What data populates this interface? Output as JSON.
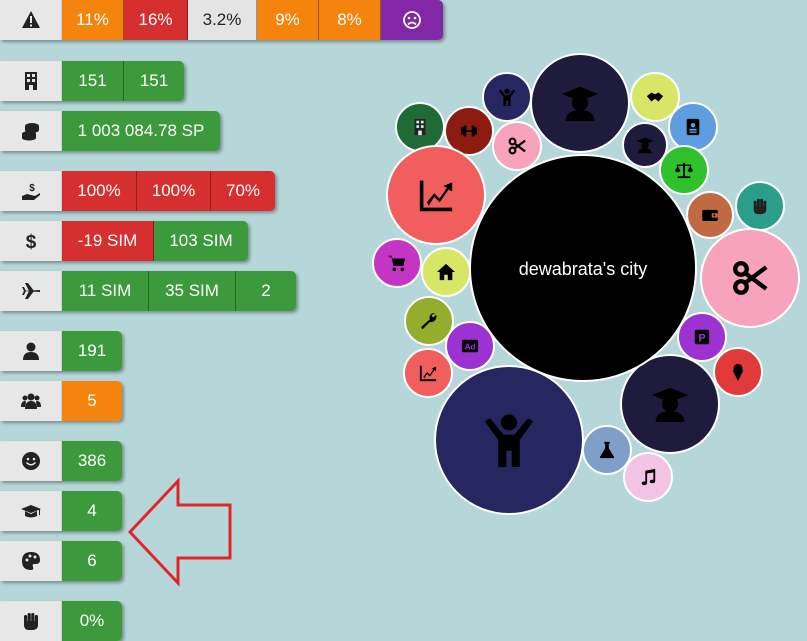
{
  "rows": [
    {
      "id": "risk",
      "icon": "warning-icon",
      "cells": [
        {
          "text": "11%",
          "color": "orange",
          "w": 61
        },
        {
          "text": "16%",
          "color": "red",
          "w": 63
        },
        {
          "text": "3.2%",
          "color": "gray",
          "w": 68
        },
        {
          "text": "9%",
          "color": "orange",
          "w": 61
        },
        {
          "text": "8%",
          "color": "orange",
          "w": 61
        },
        {
          "text": "",
          "icon": "sad-face-icon",
          "color": "purple",
          "w": 62
        }
      ]
    },
    {
      "id": "buildings",
      "icon": "building-icon",
      "cells": [
        {
          "text": "151",
          "color": "green",
          "w": 61
        },
        {
          "text": "151",
          "color": "green",
          "w": 60
        }
      ]
    },
    {
      "id": "money",
      "icon": "coins-icon",
      "cells": [
        {
          "text": "1 003 084.78 SP",
          "color": "green",
          "w": 158
        }
      ]
    },
    {
      "id": "taxes",
      "icon": "hand-dollar-icon",
      "cells": [
        {
          "text": "100%",
          "color": "red",
          "w": 74
        },
        {
          "text": "100%",
          "color": "red",
          "w": 73
        },
        {
          "text": "70%",
          "color": "red",
          "w": 64
        }
      ]
    },
    {
      "id": "balance",
      "icon": "dollar-icon",
      "cells": [
        {
          "text": "-19 SIM",
          "color": "red",
          "w": 91
        },
        {
          "text": "103 SIM",
          "color": "green",
          "w": 94
        }
      ]
    },
    {
      "id": "flights",
      "icon": "airplane-icon",
      "cells": [
        {
          "text": "11 SIM",
          "color": "green",
          "w": 86
        },
        {
          "text": "35 SIM",
          "color": "green",
          "w": 86
        },
        {
          "text": "2",
          "color": "green",
          "w": 60
        }
      ]
    },
    {
      "id": "population",
      "icon": "person-icon",
      "cells": [
        {
          "text": "191",
          "color": "green",
          "w": 60
        }
      ]
    },
    {
      "id": "groups",
      "icon": "people-group-icon",
      "cells": [
        {
          "text": "5",
          "color": "orange",
          "w": 60
        }
      ]
    },
    {
      "id": "happiness",
      "icon": "smile-icon",
      "cells": [
        {
          "text": "386",
          "color": "green",
          "w": 60
        }
      ]
    },
    {
      "id": "education",
      "icon": "graduation-cap-icon",
      "cells": [
        {
          "text": "4",
          "color": "green",
          "w": 60
        }
      ]
    },
    {
      "id": "culture",
      "icon": "palette-icon",
      "cells": [
        {
          "text": "6",
          "color": "green",
          "w": 60
        }
      ]
    },
    {
      "id": "protest",
      "icon": "fist-icon",
      "cells": [
        {
          "text": "0%",
          "color": "green",
          "w": 60
        }
      ]
    }
  ],
  "city": {
    "name": "dewabrata's city",
    "bubbles": [
      {
        "icon": "student-icon",
        "color": "#1e1b3d"
      },
      {
        "icon": "child-icon",
        "color": "#262660"
      },
      {
        "icon": "handshake-icon",
        "color": "#d8e668"
      },
      {
        "icon": "building-icon",
        "color": "#1e6b35"
      },
      {
        "icon": "dumbbell-icon",
        "color": "#8c1c0f"
      },
      {
        "icon": "scissors-icon",
        "color": "#f7a3bd"
      },
      {
        "icon": "student-icon",
        "color": "#1e1b3d"
      },
      {
        "icon": "id-card-icon",
        "color": "#5d9de0"
      },
      {
        "icon": "balance-scale-icon",
        "color": "#2ec12c"
      },
      {
        "icon": "chart-up-icon",
        "color": "#f05e5e"
      },
      {
        "icon": "wallet-icon",
        "color": "#c06a44"
      },
      {
        "icon": "fist-icon",
        "color": "#2b9f8a"
      },
      {
        "icon": "scissors-icon",
        "color": "#f7a3bd"
      },
      {
        "icon": "cart-icon",
        "color": "#c435c4"
      },
      {
        "icon": "home-icon",
        "color": "#d8e668"
      },
      {
        "icon": "wrench-icon",
        "color": "#94ad2c"
      },
      {
        "icon": "ad-icon",
        "color": "#9b32d1"
      },
      {
        "icon": "parking-icon",
        "color": "#9b32d1"
      },
      {
        "icon": "chart-up-icon",
        "color": "#f05e5e"
      },
      {
        "icon": "ice-cream-icon",
        "color": "#e03a3a"
      },
      {
        "icon": "student-icon",
        "color": "#1e1b3d"
      },
      {
        "icon": "child-icon",
        "color": "#262660"
      },
      {
        "icon": "flask-icon",
        "color": "#7f9fc8"
      },
      {
        "icon": "music-icon",
        "color": "#f2c3e5"
      }
    ]
  },
  "colors": {
    "orange": "#f4840d",
    "red": "#d62f2f",
    "gray": "#e4e4e4",
    "green": "#3d9a3c",
    "purple": "#8227a8",
    "arrow": "#e3242b",
    "background": "#b6d7d9"
  }
}
